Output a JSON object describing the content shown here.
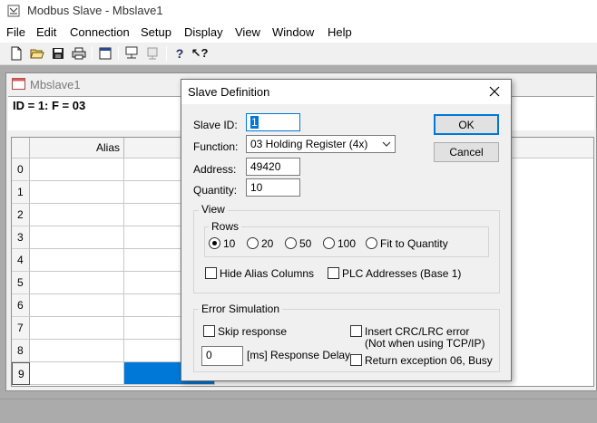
{
  "app": {
    "title": "Modbus Slave - Mbslave1"
  },
  "menu": [
    "File",
    "Edit",
    "Connection",
    "Setup",
    "Display",
    "View",
    "Window",
    "Help"
  ],
  "toolbar": {
    "icons": [
      "new-icon",
      "open-icon",
      "save-icon",
      "print-icon",
      "window-icon",
      "connect-icon",
      "disconnect-icon",
      "help-icon",
      "context-help-icon"
    ]
  },
  "child": {
    "title": "Mbslave1",
    "status": "ID = 1: F = 03",
    "grid": {
      "column_header": "Alias",
      "rows": [
        "0",
        "1",
        "2",
        "3",
        "4",
        "5",
        "6",
        "7",
        "8",
        "9"
      ],
      "selected_row": "9"
    }
  },
  "dialog": {
    "title": "Slave Definition",
    "slave_id_label": "Slave ID:",
    "slave_id_value": "1",
    "function_label": "Function:",
    "function_value": "03 Holding Register (4x)",
    "address_label": "Address:",
    "address_value": "49420",
    "quantity_label": "Quantity:",
    "quantity_value": "10",
    "ok_label": "OK",
    "cancel_label": "Cancel",
    "view": {
      "title": "View",
      "rows_title": "Rows",
      "rows_options": [
        "10",
        "20",
        "50",
        "100",
        "Fit to Quantity"
      ],
      "rows_selected": "10",
      "hide_alias_label": "Hide Alias Columns",
      "plc_addresses_label": "PLC Addresses (Base 1)"
    },
    "error": {
      "title": "Error Simulation",
      "skip_response_label": "Skip response",
      "insert_crc_label": "Insert CRC/LRC error",
      "insert_crc_note": "(Not when using TCP/IP)",
      "response_delay_value": "0",
      "response_delay_label": "[ms] Response Delay",
      "return_exception_label": "Return exception 06, Busy"
    }
  },
  "colors": {
    "accent": "#0078d7",
    "selection": "#0078d7",
    "mdi_background": "#ababab"
  }
}
